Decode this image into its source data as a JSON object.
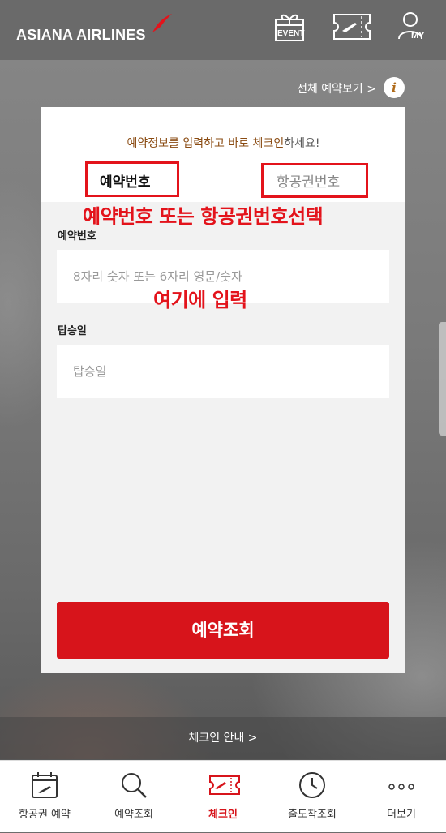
{
  "header": {
    "logo_text": "ASIANA AIRLINES",
    "event_label": "EVENT",
    "my_label": "MY"
  },
  "top_links": {
    "view_all": "전체 예약보기 >",
    "info_glyph": "i"
  },
  "form": {
    "prompt_highlight": "예약정보를 입력하고 바로 체크인",
    "prompt_rest": "하세요!",
    "tabs": [
      {
        "label": "예약번호",
        "selected": true
      },
      {
        "label": "항공권번호",
        "selected": false
      }
    ],
    "annotation_tabs": "예약번호 또는 항공권번호선택",
    "reservation_label": "예약번호",
    "reservation_placeholder": "8자리 숫자 또는 6자리 영문/숫자",
    "annotation_input": "여기에 입력",
    "date_label": "탑승일",
    "date_placeholder": "탑승일",
    "submit_label": "예약조회"
  },
  "guide": {
    "label": "체크인 안내 >"
  },
  "bottom_nav": {
    "items": [
      {
        "label": "항공권 예약",
        "icon": "calendar-plane-icon",
        "active": false
      },
      {
        "label": "예약조회",
        "icon": "search-icon",
        "active": false
      },
      {
        "label": "체크인",
        "icon": "ticket-icon",
        "active": true
      },
      {
        "label": "출도착조회",
        "icon": "clock-icon",
        "active": false
      },
      {
        "label": "더보기",
        "icon": "more-icon",
        "active": false
      }
    ]
  },
  "colors": {
    "brand_red": "#d7141b",
    "annotation_red": "#e3131b",
    "prompt_brown": "#8a4b12"
  }
}
